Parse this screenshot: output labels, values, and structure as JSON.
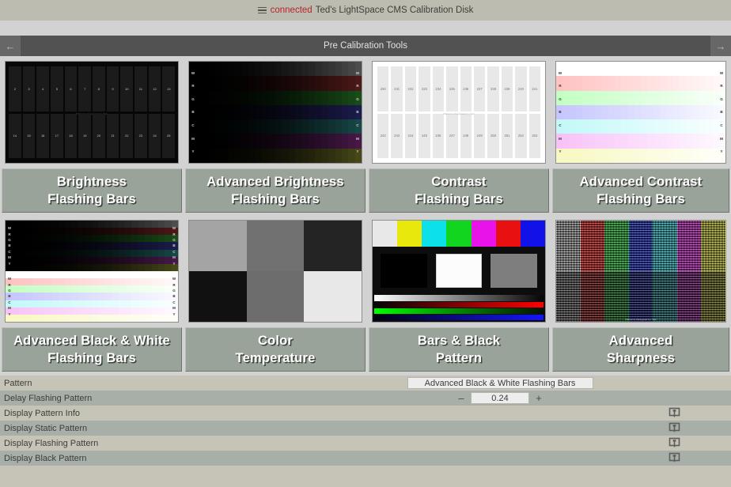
{
  "header": {
    "menu_icon": "hamburger-menu-icon",
    "status": "connected",
    "title": "Ted's LightSpace CMS Calibration Disk"
  },
  "nav": {
    "back_icon": "arrow-left-icon",
    "forward_icon": "arrow-right-icon",
    "title": "Pre Calibration Tools"
  },
  "tiles": [
    {
      "label_line1": "Brightness",
      "label_line2": "Flashing Bars",
      "thumb": "brightness-flashing-bars"
    },
    {
      "label_line1": "Advanced Brightness",
      "label_line2": "Flashing Bars",
      "thumb": "advanced-brightness-flashing-bars"
    },
    {
      "label_line1": "Contrast",
      "label_line2": "Flashing Bars",
      "thumb": "contrast-flashing-bars"
    },
    {
      "label_line1": "Advanced Contrast",
      "label_line2": "Flashing Bars",
      "thumb": "advanced-contrast-flashing-bars"
    },
    {
      "label_line1": "Advanced Black & White",
      "label_line2": "Flashing Bars",
      "thumb": "advanced-black-white-flashing-bars"
    },
    {
      "label_line1": "Color",
      "label_line2": "Temperature",
      "thumb": "color-temperature"
    },
    {
      "label_line1": "Bars & Black",
      "label_line2": "Pattern",
      "thumb": "bars-black-pattern"
    },
    {
      "label_line1": "Advanced",
      "label_line2": "Sharpness",
      "thumb": "advanced-sharpness"
    }
  ],
  "thumb_numbers": {
    "brightness_top": [
      "2",
      "3",
      "4",
      "5",
      "6",
      "7",
      "8",
      "9",
      "10",
      "11",
      "12",
      "13"
    ],
    "brightness_bot": [
      "14",
      "15",
      "16",
      "17",
      "18",
      "19",
      "20",
      "21",
      "22",
      "23",
      "24",
      "25"
    ],
    "contrast_top": [
      "230",
      "231",
      "232",
      "233",
      "234",
      "235",
      "236",
      "237",
      "238",
      "239",
      "240",
      "241"
    ],
    "contrast_bot": [
      "242",
      "243",
      "244",
      "245",
      "246",
      "247",
      "248",
      "249",
      "250",
      "251",
      "252",
      "253"
    ],
    "channel_labels": [
      "W",
      "R",
      "G",
      "B",
      "C",
      "M",
      "Y"
    ],
    "credit": "Patterns Designed by Ted"
  },
  "panel": {
    "rows": [
      {
        "label": "Pattern",
        "control": "combo",
        "value": "Advanced Black & White Flashing Bars"
      },
      {
        "label": "Delay Flashing Pattern",
        "control": "stepper",
        "value": "0.24",
        "minus": "–",
        "plus": "+"
      },
      {
        "label": "Display Pattern Info",
        "control": "monitor",
        "icon": "monitor-icon"
      },
      {
        "label": "Display Static Pattern",
        "control": "monitor",
        "icon": "monitor-icon"
      },
      {
        "label": "Display Flashing Pattern",
        "control": "monitor",
        "icon": "monitor-icon"
      },
      {
        "label": "Display Black Pattern",
        "control": "monitor",
        "icon": "monitor-icon"
      }
    ]
  },
  "colors": {
    "header_bg": "#bdbcb0",
    "status_red": "#b6232a",
    "nav_bg": "#525252",
    "button_bg": "#9aa39a",
    "panel_bg": "#c6c4b6",
    "panel_alt_bg": "#a8afa8"
  }
}
